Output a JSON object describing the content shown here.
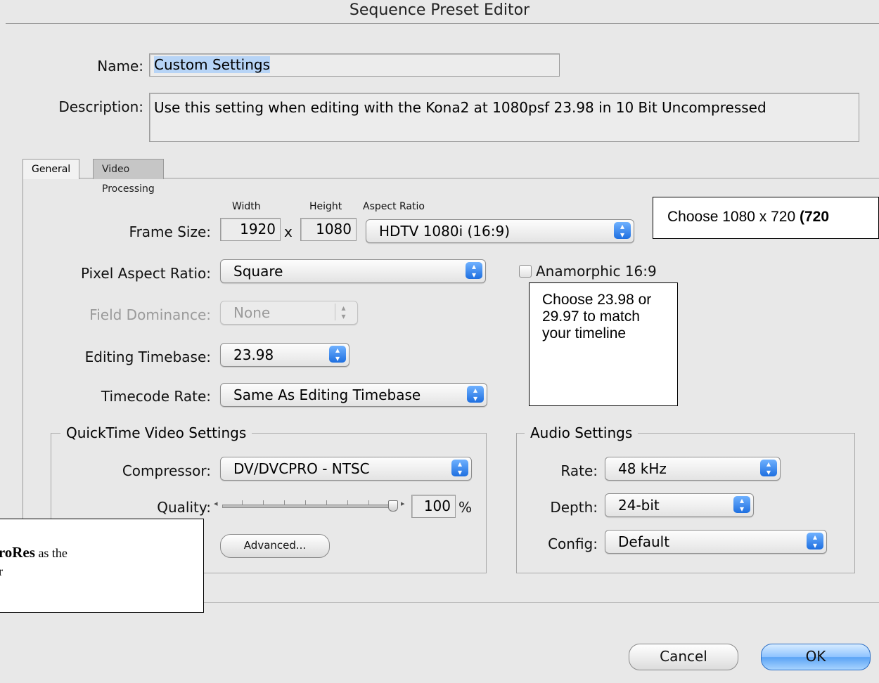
{
  "window": {
    "title": "Sequence Preset Editor"
  },
  "name_label": "Name:",
  "name_value": "Custom Settings",
  "description_label": "Description:",
  "description_value": "Use this setting when editing with the Kona2 at 1080psf 23.98 in 10 Bit Uncompressed",
  "tabs": [
    {
      "label": "General",
      "active": true
    },
    {
      "label": "Video Processing",
      "active": false
    }
  ],
  "frame_size": {
    "label": "Frame Size:",
    "width_caption": "Width",
    "height_caption": "Height",
    "aspect_caption": "Aspect Ratio",
    "width": "1920",
    "x": "x",
    "height": "1080",
    "aspect_ratio": "HDTV 1080i (16:9)"
  },
  "pixel_aspect": {
    "label": "Pixel Aspect Ratio:",
    "value": "Square"
  },
  "anamorphic": {
    "label": "Anamorphic 16:9",
    "checked": false
  },
  "field_dominance": {
    "label": "Field Dominance:",
    "value": "None",
    "enabled": false
  },
  "editing_timebase": {
    "label": "Editing Timebase:",
    "value": "23.98"
  },
  "timecode_rate": {
    "label": "Timecode Rate:",
    "value": "Same As Editing Timebase"
  },
  "quicktime": {
    "title": "QuickTime Video Settings",
    "compressor_label": "Compressor:",
    "compressor": "DV/DVCPRO - NTSC",
    "quality_label": "Quality:",
    "quality": "100",
    "quality_unit": "%",
    "advanced_label": "Advanced..."
  },
  "audio": {
    "title": "Audio Settings",
    "rate_label": "Rate:",
    "rate": "48 kHz",
    "depth_label": "Depth:",
    "depth": "24-bit",
    "config_label": "Config:",
    "config": "Default"
  },
  "buttons": {
    "cancel": "Cancel",
    "ok": "OK"
  },
  "callouts": {
    "frame_size": {
      "prefix": "Choose 1080 x 720 ",
      "bold": "(720"
    },
    "timebase": "Choose 23.98 or 29.97 to match your timeline",
    "compressor": {
      "line1_bold": "ProRes",
      "line1_rest": " as the",
      "line2": "or"
    }
  },
  "icons": {
    "popup_arrows": "up-down-arrows-icon",
    "slider_left": "slider-left-arrow-icon",
    "slider_right": "slider-right-arrow-icon"
  }
}
